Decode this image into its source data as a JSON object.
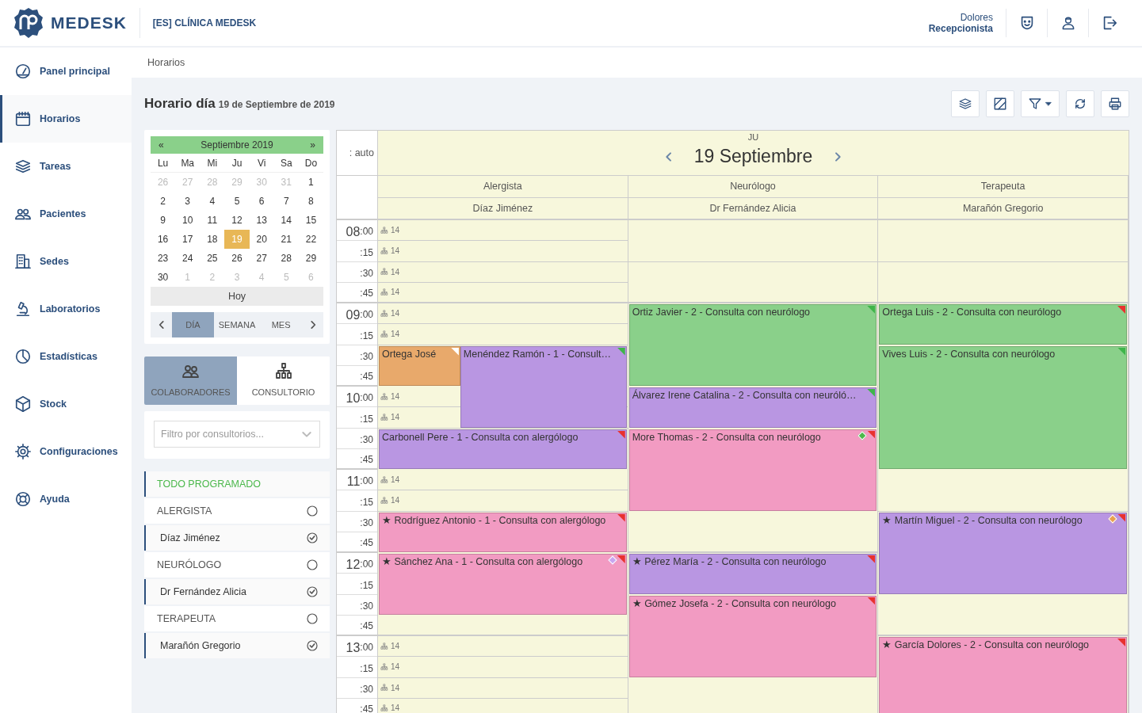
{
  "header": {
    "logo": "MEDESK",
    "clinic": "[ES] CLÍNICA MEDESK",
    "user_name": "Dolores",
    "user_role": "Recepcionista"
  },
  "sidebar": {
    "items": [
      {
        "label": "Panel principal",
        "selected": false
      },
      {
        "label": "Horarios",
        "selected": true
      },
      {
        "label": "Tareas",
        "selected": false
      },
      {
        "label": "Pacientes",
        "selected": false
      },
      {
        "label": "Sedes",
        "selected": false
      },
      {
        "label": "Laboratorios",
        "selected": false
      },
      {
        "label": "Estadísticas",
        "selected": false
      },
      {
        "label": "Stock",
        "selected": false
      },
      {
        "label": "Configuraciones",
        "selected": false
      },
      {
        "label": "Ayuda",
        "selected": false
      }
    ]
  },
  "breadcrumb": "Horarios",
  "page_title": "Horario día",
  "page_subtitle": "19 de Septiembre de 2019",
  "mini_calendar": {
    "prev": "«",
    "month": "Septiembre 2019",
    "next": "»",
    "weekdays": [
      "Lu",
      "Ma",
      "Mi",
      "Ju",
      "Vi",
      "Sa",
      "Do"
    ],
    "weeks": [
      [
        {
          "day": "26",
          "muted": true,
          "selected": false
        },
        {
          "day": "27",
          "muted": true,
          "selected": false
        },
        {
          "day": "28",
          "muted": true,
          "selected": false
        },
        {
          "day": "29",
          "muted": true,
          "selected": false
        },
        {
          "day": "30",
          "muted": true,
          "selected": false
        },
        {
          "day": "31",
          "muted": true,
          "selected": false
        },
        {
          "day": "1",
          "muted": false,
          "selected": false
        }
      ],
      [
        {
          "day": "2",
          "muted": false,
          "selected": false
        },
        {
          "day": "3",
          "muted": false,
          "selected": false
        },
        {
          "day": "4",
          "muted": false,
          "selected": false
        },
        {
          "day": "5",
          "muted": false,
          "selected": false
        },
        {
          "day": "6",
          "muted": false,
          "selected": false
        },
        {
          "day": "7",
          "muted": false,
          "selected": false
        },
        {
          "day": "8",
          "muted": false,
          "selected": false
        }
      ],
      [
        {
          "day": "9",
          "muted": false,
          "selected": false
        },
        {
          "day": "10",
          "muted": false,
          "selected": false
        },
        {
          "day": "11",
          "muted": false,
          "selected": false
        },
        {
          "day": "12",
          "muted": false,
          "selected": false
        },
        {
          "day": "13",
          "muted": false,
          "selected": false
        },
        {
          "day": "14",
          "muted": false,
          "selected": false
        },
        {
          "day": "15",
          "muted": false,
          "selected": false
        }
      ],
      [
        {
          "day": "16",
          "muted": false,
          "selected": false
        },
        {
          "day": "17",
          "muted": false,
          "selected": false
        },
        {
          "day": "18",
          "muted": false,
          "selected": false
        },
        {
          "day": "19",
          "muted": false,
          "selected": true
        },
        {
          "day": "20",
          "muted": false,
          "selected": false
        },
        {
          "day": "21",
          "muted": false,
          "selected": false
        },
        {
          "day": "22",
          "muted": false,
          "selected": false
        }
      ],
      [
        {
          "day": "23",
          "muted": false,
          "selected": false
        },
        {
          "day": "24",
          "muted": false,
          "selected": false
        },
        {
          "day": "25",
          "muted": false,
          "selected": false
        },
        {
          "day": "26",
          "muted": false,
          "selected": false
        },
        {
          "day": "27",
          "muted": false,
          "selected": false
        },
        {
          "day": "28",
          "muted": false,
          "selected": false
        },
        {
          "day": "29",
          "muted": false,
          "selected": false
        }
      ],
      [
        {
          "day": "30",
          "muted": false,
          "selected": false
        },
        {
          "day": "1",
          "muted": true,
          "selected": false
        },
        {
          "day": "2",
          "muted": true,
          "selected": false
        },
        {
          "day": "3",
          "muted": true,
          "selected": false
        },
        {
          "day": "4",
          "muted": true,
          "selected": false
        },
        {
          "day": "5",
          "muted": true,
          "selected": false
        },
        {
          "day": "6",
          "muted": true,
          "selected": false
        }
      ]
    ],
    "today_button": "Hoy",
    "views": [
      {
        "label": "DÍA",
        "selected": true
      },
      {
        "label": "SEMANA",
        "selected": false
      },
      {
        "label": "MES",
        "selected": false
      }
    ]
  },
  "resource_tabs": [
    {
      "label": "COLABORADORES",
      "selected": true
    },
    {
      "label": "CONSULTORIO",
      "selected": false
    }
  ],
  "filter": {
    "placeholder": "Filtro por consultorios..."
  },
  "resource_list": [
    {
      "kind": "all",
      "label": "TODO PROGRAMADO"
    },
    {
      "kind": "group",
      "label": "ALERGISTA",
      "checked": false
    },
    {
      "kind": "person",
      "label": "Díaz Jiménez",
      "checked": true
    },
    {
      "kind": "group",
      "label": "NEURÓLOGO",
      "checked": false
    },
    {
      "kind": "person",
      "label": "Dr Fernández Alicia",
      "checked": true
    },
    {
      "kind": "group",
      "label": "TERAPEUTA",
      "checked": false
    },
    {
      "kind": "person",
      "label": "Marañón Gregorio",
      "checked": true
    }
  ],
  "calendar": {
    "auto_label": ": auto",
    "day_abbr": "JU",
    "date": "19 Septiembre",
    "rows": [
      {
        "hour": "08",
        "minutes": ":00"
      },
      {
        "minutes": ":15"
      },
      {
        "minutes": ":30"
      },
      {
        "minutes": ":45"
      },
      {
        "hour": "09",
        "minutes": ":00"
      },
      {
        "minutes": ":15"
      },
      {
        "minutes": ":30"
      },
      {
        "minutes": ":45"
      },
      {
        "hour": "10",
        "minutes": ":00"
      },
      {
        "minutes": ":15"
      },
      {
        "minutes": ":30"
      },
      {
        "minutes": ":45"
      },
      {
        "hour": "11",
        "minutes": ":00"
      },
      {
        "minutes": ":15"
      },
      {
        "minutes": ":30"
      },
      {
        "minutes": ":45"
      },
      {
        "hour": "12",
        "minutes": ":00"
      },
      {
        "minutes": ":15"
      },
      {
        "minutes": ":30"
      },
      {
        "minutes": ":45"
      },
      {
        "hour": "13",
        "minutes": ":00"
      },
      {
        "minutes": ":15"
      },
      {
        "minutes": ":30"
      },
      {
        "minutes": ":45"
      }
    ],
    "columns": [
      {
        "specialty": "Alergista",
        "name": "Díaz Jiménez",
        "slots": [
          {
            "kind": "free",
            "label": "14"
          },
          {
            "kind": "free",
            "label": "14"
          },
          {
            "kind": "free",
            "label": "14"
          },
          {
            "kind": "free",
            "label": "14"
          },
          {
            "kind": "free",
            "label": "14"
          },
          {
            "kind": "free",
            "label": "14"
          },
          {
            "kind": "start",
            "events": [
              {
                "kind": "narrow",
                "title": "Ortega José",
                "color": "#e8a96b",
                "flag": {
                  "color": "#ffffff"
                }
              },
              {
                "kind": "wide",
                "title": "Menéndez Ramón - 1 - Consult…",
                "color": "#b996e2",
                "flag": {
                  "color": "#3fb54a"
                }
              }
            ]
          },
          {
            "kind": "busy"
          },
          {
            "kind": "free",
            "label": "14",
            "overlapped": true
          },
          {
            "kind": "free",
            "label": "14",
            "overlapped": true
          },
          {
            "kind": "start",
            "events": [
              {
                "kind": "full",
                "title": "Carbonell Pere - 1 - Consulta con alergólogo",
                "color": "#b996e2",
                "flag": {
                  "color": "#e8312f"
                }
              }
            ]
          },
          {
            "kind": "busy"
          },
          {
            "kind": "free",
            "label": "14"
          },
          {
            "kind": "free",
            "label": "14"
          },
          {
            "kind": "start",
            "events": [
              {
                "kind": "full",
                "star": "★",
                "title": "Rodríguez Antonio - 1 - Consulta con alergólogo",
                "color": "#f29bc2",
                "flag": {
                  "color": "#e8312f"
                }
              }
            ]
          },
          {
            "kind": "busy"
          },
          {
            "kind": "start",
            "events": [
              {
                "kind": "full",
                "star": "★",
                "title": "Sánchez Ana - 1 - Consulta con alergólogo",
                "color": "#f29bc2",
                "flag": {
                  "color": "#e8312f"
                },
                "marker": {
                  "color": "#c9a6f0"
                }
              }
            ]
          },
          {
            "kind": "busy"
          },
          {
            "kind": "busy"
          },
          {
            "kind": "empty"
          },
          {
            "kind": "free",
            "label": "14"
          },
          {
            "kind": "free",
            "label": "14"
          },
          {
            "kind": "free",
            "label": "14"
          },
          {
            "kind": "free",
            "label": "14"
          }
        ]
      },
      {
        "specialty": "Neurólogo",
        "name": "Dr Fernández Alicia",
        "slots": [
          {
            "kind": "empty"
          },
          {
            "kind": "empty"
          },
          {
            "kind": "empty"
          },
          {
            "kind": "empty"
          },
          {
            "kind": "start",
            "events": [
              {
                "kind": "full",
                "title": "Ortiz Javier - 2 - Consulta con neurólogo",
                "color": "#8ad08a",
                "flag": {
                  "color": "#3fb54a"
                }
              }
            ]
          },
          {
            "kind": "busy"
          },
          {
            "kind": "busy"
          },
          {
            "kind": "busy"
          },
          {
            "kind": "start",
            "events": [
              {
                "kind": "full",
                "title": "Álvarez Irene Catalina - 2 - Consulta con neuróló…",
                "color": "#b996e2",
                "flag": {
                  "color": "#3fb54a"
                }
              }
            ]
          },
          {
            "kind": "busy"
          },
          {
            "kind": "start",
            "events": [
              {
                "kind": "full",
                "title": "More Thomas - 2 - Consulta con neurólogo",
                "color": "#f29bc2",
                "flag": {
                  "color": "#e8312f"
                },
                "marker": {
                  "color": "#4cb84c"
                }
              }
            ]
          },
          {
            "kind": "busy"
          },
          {
            "kind": "busy"
          },
          {
            "kind": "busy"
          },
          {
            "kind": "empty"
          },
          {
            "kind": "empty"
          },
          {
            "kind": "start",
            "events": [
              {
                "kind": "full",
                "star": "★",
                "title": "Pérez María - 2 - Consulta con neurólogo",
                "color": "#b996e2",
                "flag": {
                  "color": "#e8312f"
                }
              }
            ]
          },
          {
            "kind": "busy"
          },
          {
            "kind": "start",
            "events": [
              {
                "kind": "full",
                "star": "★",
                "title": "Gómez Josefa - 2 - Consulta con neurólogo",
                "color": "#f29bc2",
                "flag": {
                  "color": "#e8312f"
                }
              }
            ]
          },
          {
            "kind": "busy"
          },
          {
            "kind": "busy"
          },
          {
            "kind": "busy"
          },
          {
            "kind": "empty"
          },
          {
            "kind": "empty"
          }
        ]
      },
      {
        "specialty": "Terapeuta",
        "name": "Marañón Gregorio",
        "slots": [
          {
            "kind": "empty"
          },
          {
            "kind": "empty"
          },
          {
            "kind": "empty"
          },
          {
            "kind": "empty"
          },
          {
            "kind": "start",
            "events": [
              {
                "kind": "full",
                "title": "Ortega Luis - 2 - Consulta con neurólogo",
                "color": "#8ad08a",
                "flag": {
                  "color": "#e8312f"
                }
              }
            ]
          },
          {
            "kind": "busy"
          },
          {
            "kind": "start",
            "events": [
              {
                "kind": "full",
                "title": "Vives Luis - 2 - Consulta con neurólogo",
                "color": "#8ad08a",
                "flag": {
                  "color": "#3fb54a"
                }
              }
            ]
          },
          {
            "kind": "busy"
          },
          {
            "kind": "busy"
          },
          {
            "kind": "busy"
          },
          {
            "kind": "busy"
          },
          {
            "kind": "busy"
          },
          {
            "kind": "empty"
          },
          {
            "kind": "empty"
          },
          {
            "kind": "start",
            "events": [
              {
                "kind": "full",
                "star": "★",
                "title": "Martín Miguel - 2 - Consulta con neurólogo",
                "color": "#b996e2",
                "flag": {
                  "color": "#e8312f"
                },
                "marker": {
                  "color": "#e8a04f"
                }
              }
            ]
          },
          {
            "kind": "busy"
          },
          {
            "kind": "busy"
          },
          {
            "kind": "busy"
          },
          {
            "kind": "empty"
          },
          {
            "kind": "empty"
          },
          {
            "kind": "start",
            "events": [
              {
                "kind": "full",
                "star": "★",
                "title": "García Dolores - 2 - Consulta con neurólogo",
                "color": "#f29bc2",
                "flag": {
                  "color": "#e8312f"
                }
              }
            ]
          },
          {
            "kind": "busy"
          },
          {
            "kind": "busy"
          },
          {
            "kind": "busy"
          }
        ]
      }
    ]
  }
}
